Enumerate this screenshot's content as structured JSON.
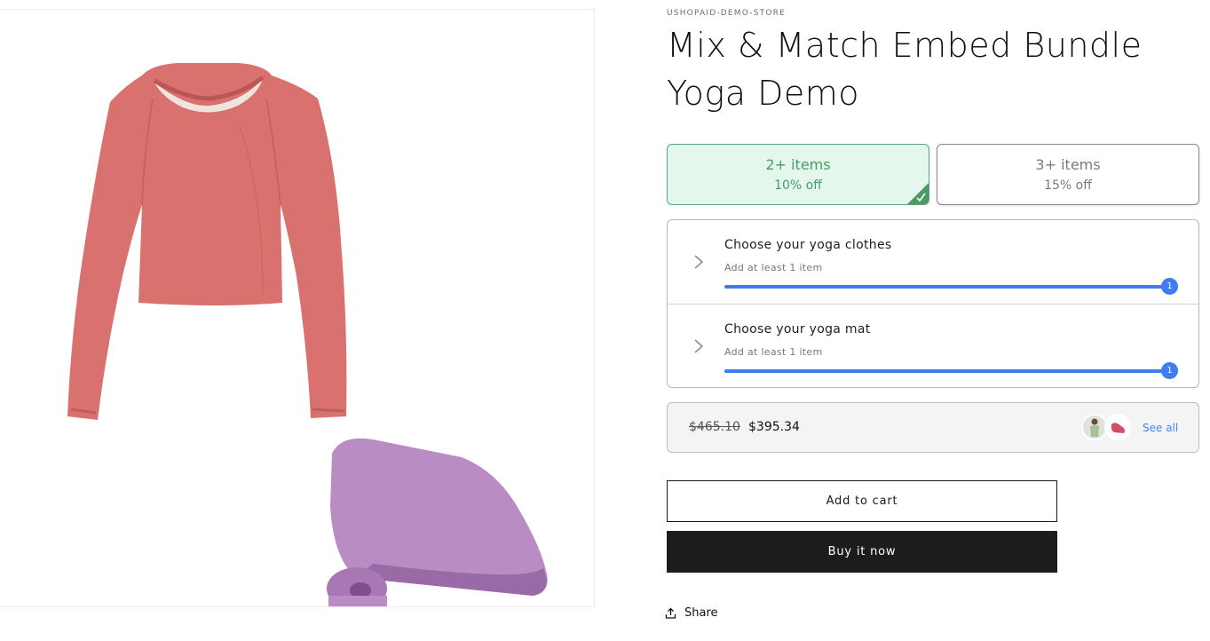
{
  "product": {
    "vendor": "USHOPAID-DEMO-STORE",
    "title": "Mix & Match Embed Bundle Yoga Demo"
  },
  "tiers": [
    {
      "label": "2+ items",
      "discount": "10% off",
      "selected": true
    },
    {
      "label": "3+ items",
      "discount": "15% off",
      "selected": false
    }
  ],
  "steps": [
    {
      "title": "Choose your yoga clothes",
      "subtitle": "Add at least 1 item",
      "count": "1",
      "progress": 1.0
    },
    {
      "title": "Choose your yoga mat",
      "subtitle": "Add at least 1 item",
      "count": "1",
      "progress": 1.0
    }
  ],
  "summary": {
    "original_price": "$465.10",
    "discounted_price": "$395.34",
    "see_all_label": "See all"
  },
  "buttons": {
    "add_to_cart": "Add to cart",
    "buy_now": "Buy it now",
    "share": "Share"
  },
  "colors": {
    "selected_tier_bg": "#e3f7ec",
    "selected_tier_accent": "#4c9a66",
    "progress": "#3e7cef",
    "buy_button": "#1c1c1c"
  }
}
